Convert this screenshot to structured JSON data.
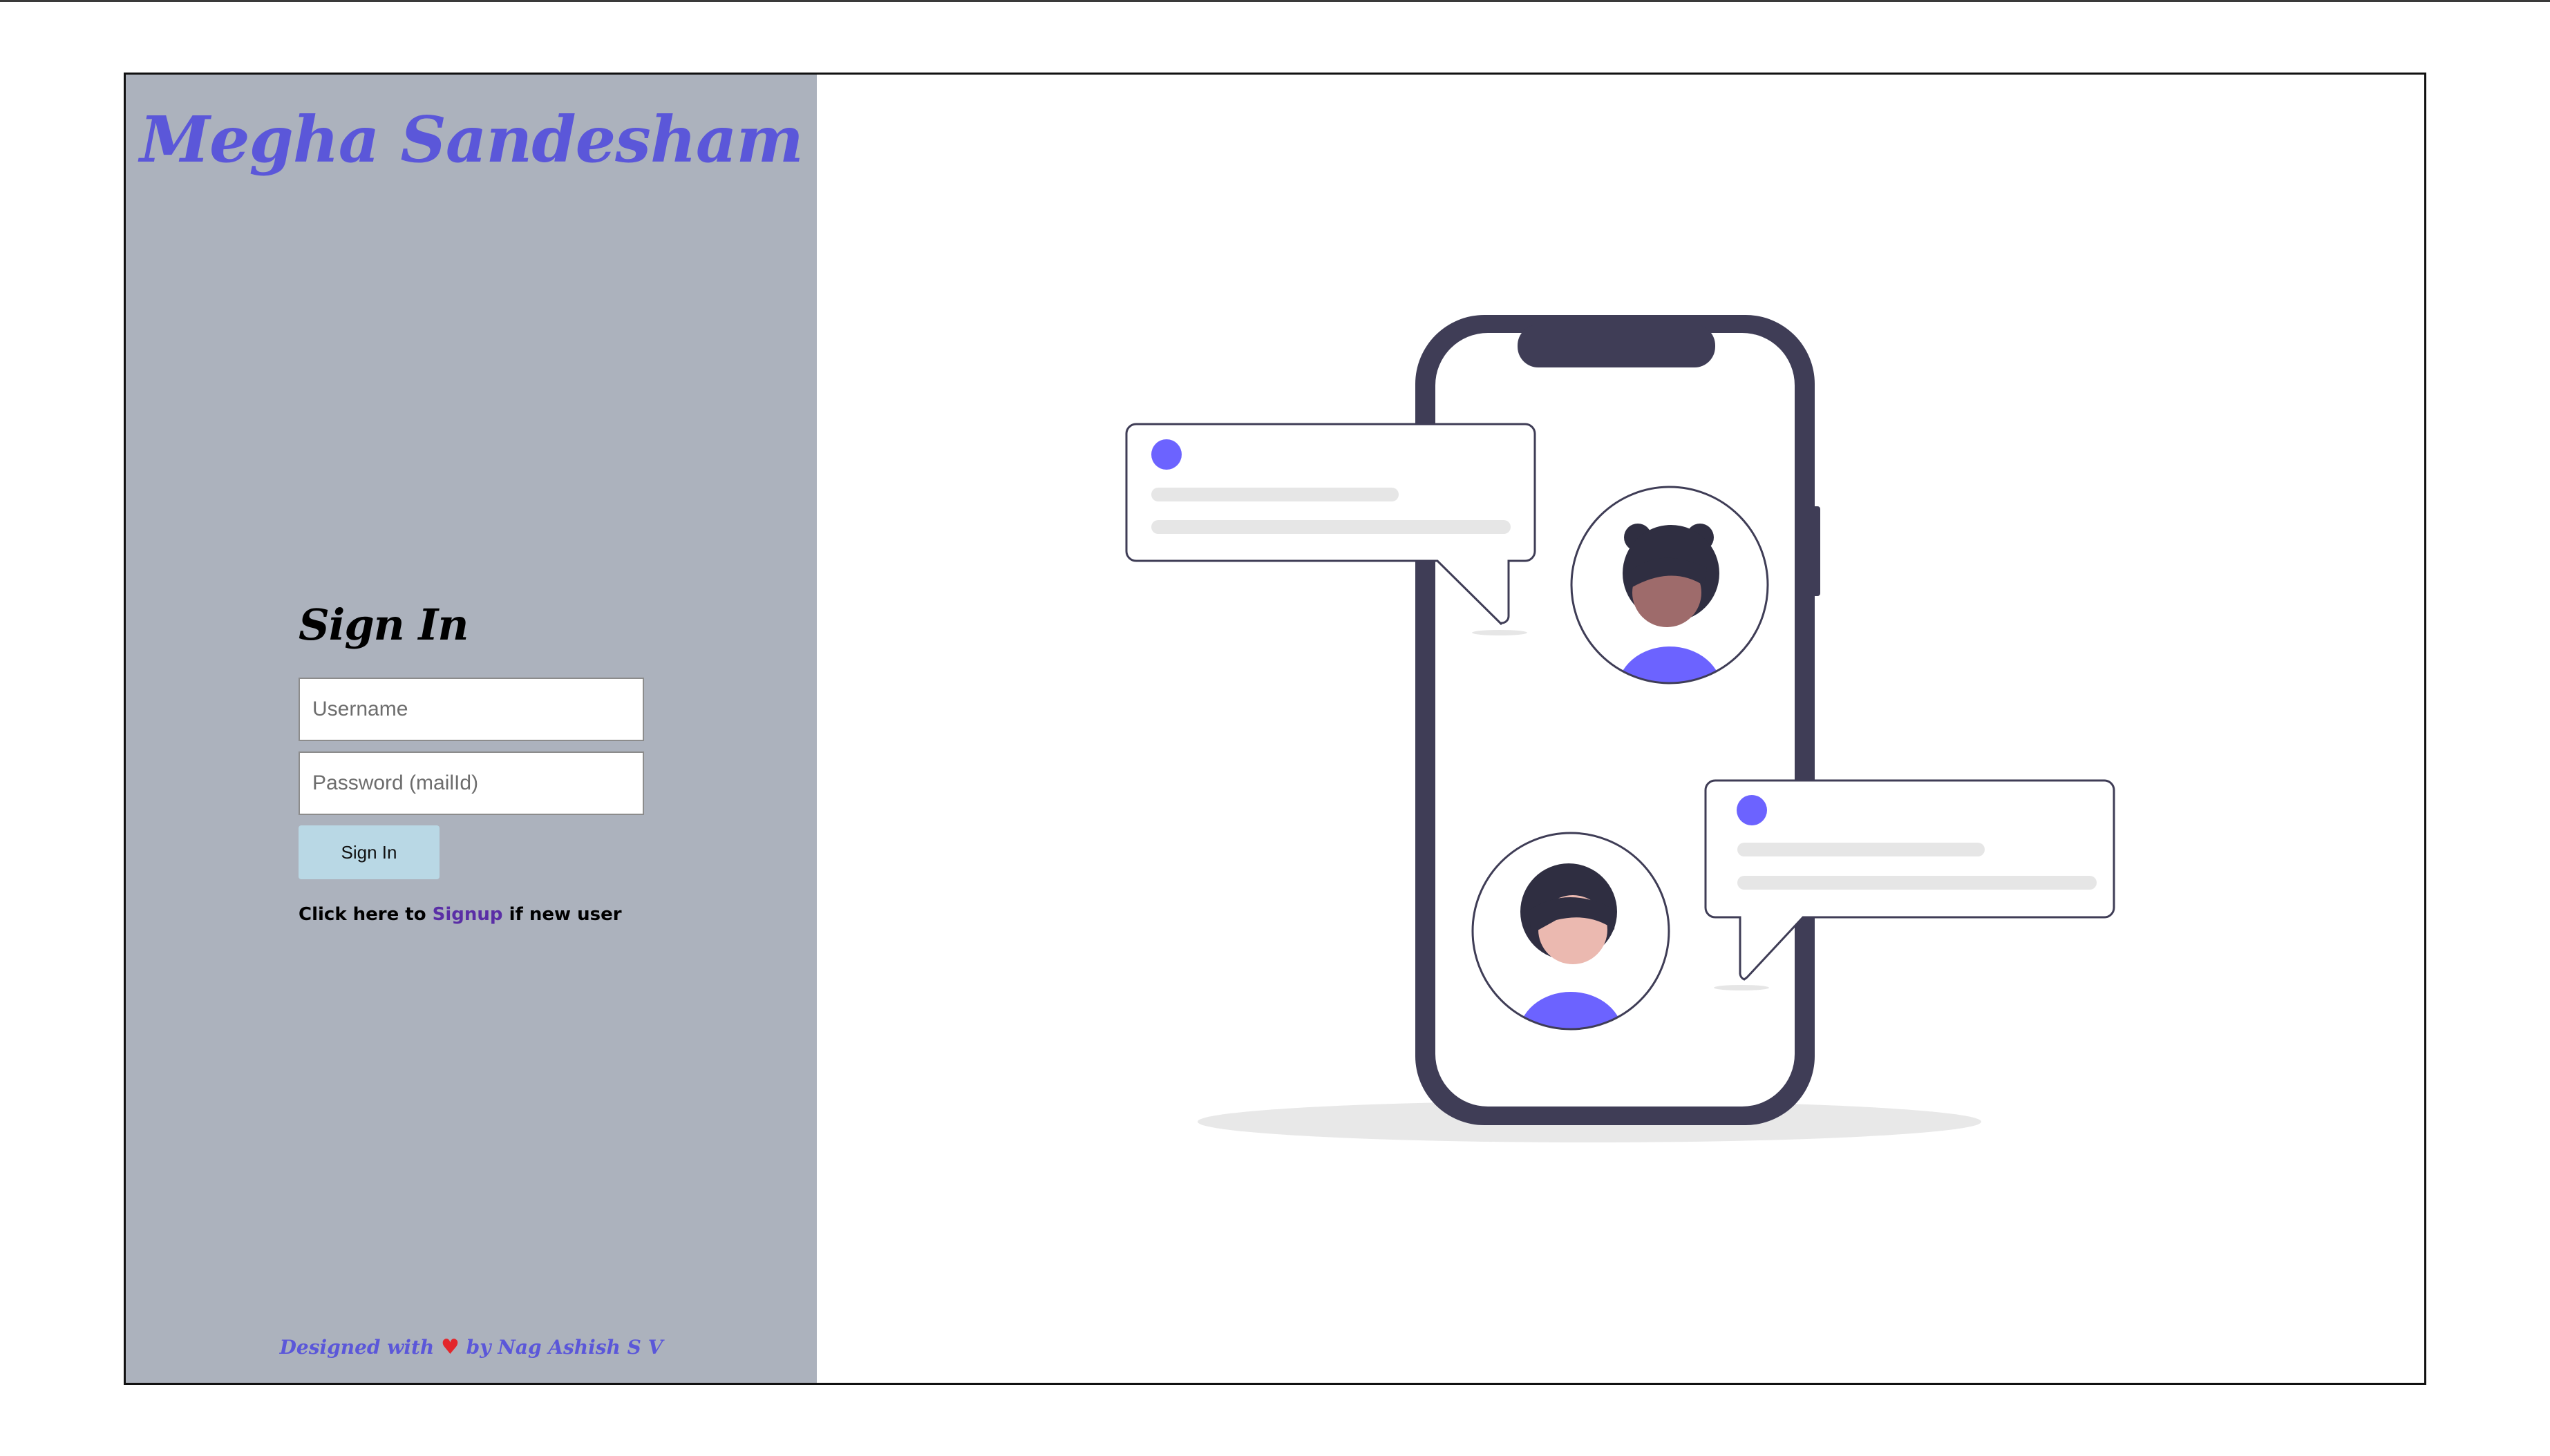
{
  "brand": {
    "title": "Megha Sandesham"
  },
  "signin": {
    "heading": "Sign In",
    "username_placeholder": "Username",
    "password_placeholder": "Password (mailId)",
    "button_label": "Sign In",
    "signup_prefix": "Click here to ",
    "signup_link": "Signup",
    "signup_suffix": " if new user"
  },
  "footer": {
    "prefix": "Designed with ",
    "heart": "♥",
    "suffix": " by Nag Ashish S V"
  },
  "colors": {
    "brand_accent": "#5b57d9",
    "side_panel": "#acb2bd",
    "signin_button": "#b9d8e5",
    "illustration_purple": "#6c63ff",
    "phone_frame": "#3f3d56"
  },
  "icons": {
    "heart": "heart-icon"
  }
}
